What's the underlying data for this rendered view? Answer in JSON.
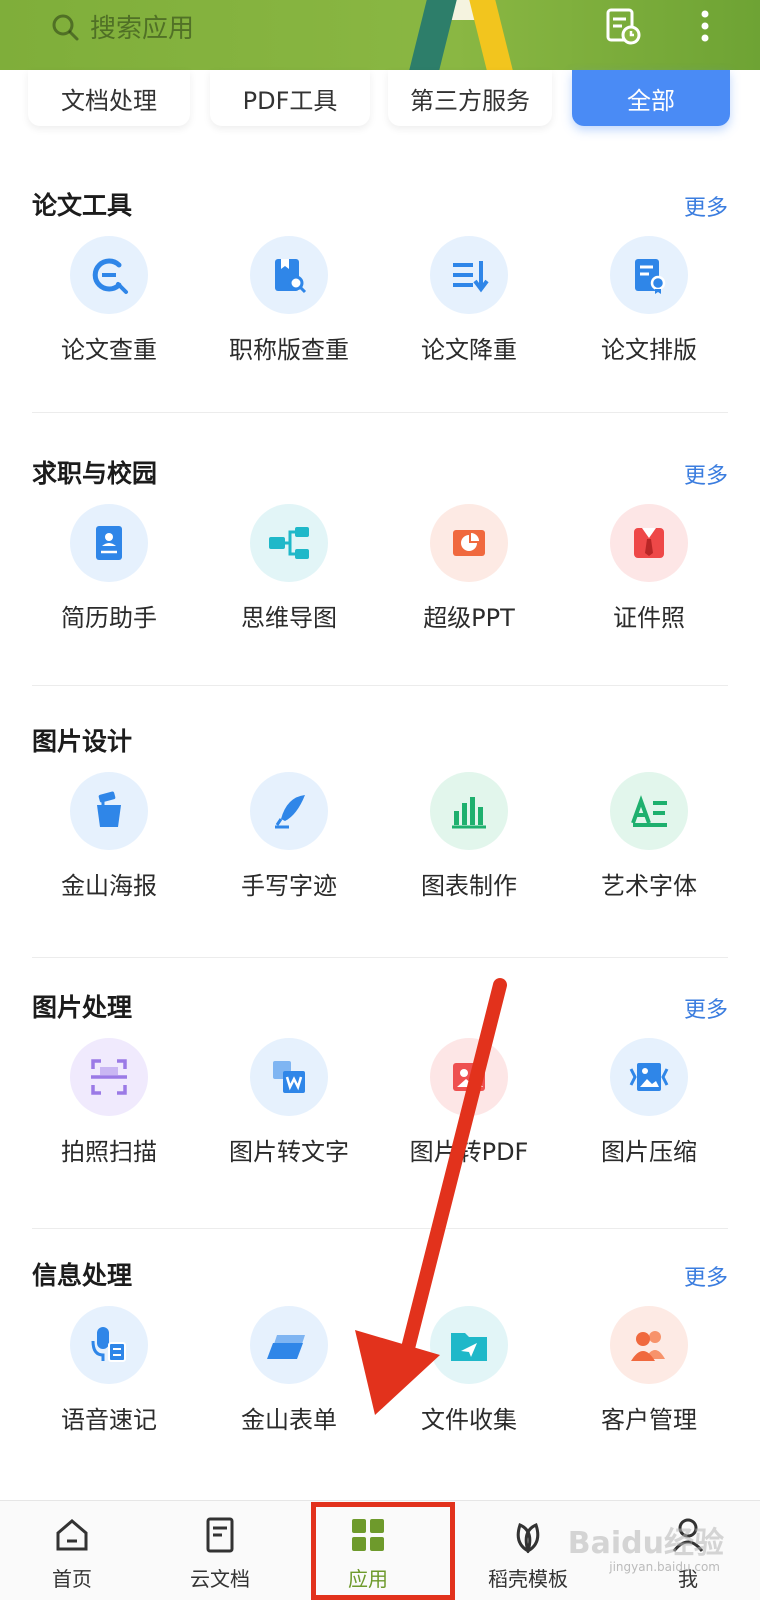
{
  "header": {
    "search_placeholder": "搜索应用"
  },
  "tabs": [
    {
      "label": "文档处理",
      "active": false
    },
    {
      "label": "PDF工具",
      "active": false
    },
    {
      "label": "第三方服务",
      "active": false
    },
    {
      "label": "全部",
      "active": true
    }
  ],
  "more_label": "更多",
  "sections": [
    {
      "title": "论文工具",
      "has_more": true,
      "items": [
        {
          "label": "论文查重",
          "icon": "thesis-check-icon"
        },
        {
          "label": "职称版查重",
          "icon": "title-check-icon"
        },
        {
          "label": "论文降重",
          "icon": "reduce-duplicate-icon"
        },
        {
          "label": "论文排版",
          "icon": "thesis-layout-icon"
        }
      ]
    },
    {
      "title": "求职与校园",
      "has_more": true,
      "items": [
        {
          "label": "简历助手",
          "icon": "resume-icon"
        },
        {
          "label": "思维导图",
          "icon": "mindmap-icon"
        },
        {
          "label": "超级PPT",
          "icon": "ppt-icon"
        },
        {
          "label": "证件照",
          "icon": "id-photo-icon"
        }
      ]
    },
    {
      "title": "图片设计",
      "has_more": false,
      "items": [
        {
          "label": "金山海报",
          "icon": "poster-icon"
        },
        {
          "label": "手写字迹",
          "icon": "handwriting-icon"
        },
        {
          "label": "图表制作",
          "icon": "chart-maker-icon"
        },
        {
          "label": "艺术字体",
          "icon": "art-font-icon"
        }
      ]
    },
    {
      "title": "图片处理",
      "has_more": true,
      "items": [
        {
          "label": "拍照扫描",
          "icon": "scan-icon"
        },
        {
          "label": "图片转文字",
          "icon": "image-to-text-icon"
        },
        {
          "label": "图片转PDF",
          "icon": "image-to-pdf-icon"
        },
        {
          "label": "图片压缩",
          "icon": "image-compress-icon"
        }
      ]
    },
    {
      "title": "信息处理",
      "has_more": true,
      "items": [
        {
          "label": "语音速记",
          "icon": "voice-note-icon"
        },
        {
          "label": "金山表单",
          "icon": "form-icon"
        },
        {
          "label": "文件收集",
          "icon": "file-collect-icon"
        },
        {
          "label": "客户管理",
          "icon": "customer-icon"
        }
      ]
    }
  ],
  "bottom_nav": [
    {
      "label": "首页",
      "icon": "home-icon",
      "active": false
    },
    {
      "label": "云文档",
      "icon": "cloud-doc-icon",
      "active": false
    },
    {
      "label": "应用",
      "icon": "apps-grid-icon",
      "active": true
    },
    {
      "label": "稻壳模板",
      "icon": "template-leaf-icon",
      "active": false
    },
    {
      "label": "我",
      "icon": "profile-icon",
      "active": false
    }
  ],
  "colors": {
    "accent_blue": "#4a8bf5",
    "nav_active": "#6e9a2c",
    "annotation_red": "#e2321c",
    "header_green": "#8ab743"
  },
  "watermark": {
    "brand": "Baidu经验",
    "sub": "jingyan.baidu.com"
  }
}
